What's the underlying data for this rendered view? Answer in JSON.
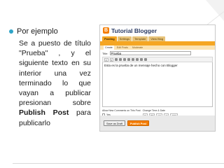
{
  "slide": {
    "bullet": "Por ejemplo",
    "body": {
      "part1": "Se a  puesto de título \"Prueba\" , y el siguiente texto en su interior una vez terminado lo que vayan a publicar presionan sobre ",
      "strong": "Publish Post",
      "part2": " para publicarlo"
    },
    "accent_color": "#2fa4c7"
  },
  "blogger": {
    "blog_title": "Tutorial Blogger",
    "logo_letter": "B",
    "tabs": [
      "Posting",
      "Settings",
      "Template",
      "View Blog"
    ],
    "subtabs": [
      "Create",
      "Edit Posts",
      "Moderate"
    ],
    "title_label": "Title:",
    "title_value": "Prueba",
    "editor_text": "Esta es la prueba de un mensaje hecho con Blogger",
    "options": {
      "comments_label": "Allow New Comments on This Post",
      "comments_value": "Yes",
      "time_label": "Change Time & Date",
      "time_values": [
        "10",
        "PM",
        "Oct",
        "14",
        "2004"
      ]
    },
    "buttons": {
      "draft": "Save as Draft",
      "publish": "Publish Post"
    },
    "brand_color": "#f57d00",
    "tab_color": "#f5a623"
  }
}
